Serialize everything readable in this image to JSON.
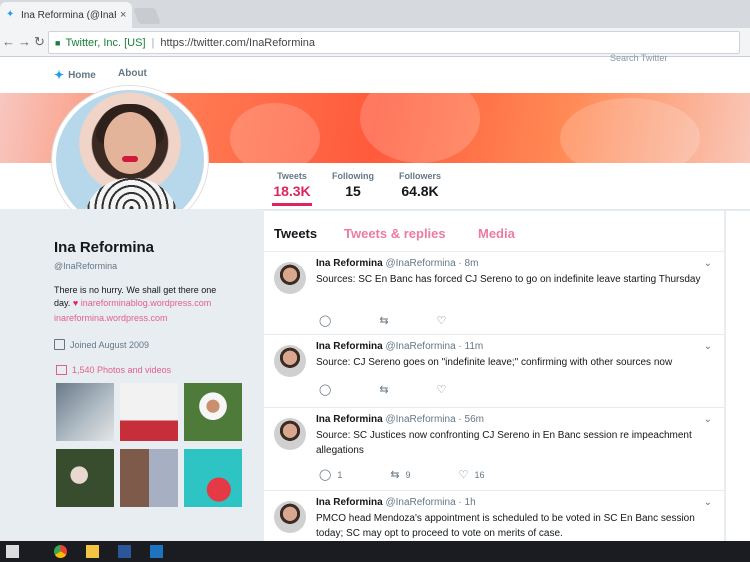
{
  "browser": {
    "tab_title": "Ina Reformina (@InaRef",
    "tab_close": "×",
    "org": "Twitter, Inc. [US]",
    "url": "https://twitter.com/InaReformina"
  },
  "twitter_nav": {
    "home_label": "Home",
    "about_label": "About",
    "search_placeholder": "Search Twitter"
  },
  "profile_stats": [
    {
      "label": "Tweets",
      "value": "18.3K"
    },
    {
      "label": "Following",
      "value": "15"
    },
    {
      "label": "Followers",
      "value": "64.8K"
    }
  ],
  "profile": {
    "name": "Ina Reformina",
    "handle": "@InaReformina",
    "bio_line1": "There is no hurry. We shall get there one",
    "bio_line2_start": "day.",
    "bio_link1": "inareforminablog.wordpress.com",
    "bio_link2": "inareformina.wordpress.com",
    "joined": "Joined August 2009",
    "photos": "1,540 Photos and videos"
  },
  "timeline_tabs": [
    {
      "label": "Tweets",
      "color": "#14171a"
    },
    {
      "label": "Tweets & replies",
      "color": "#e0245e"
    },
    {
      "label": "Media",
      "color": "#e0245e"
    }
  ],
  "tweets": [
    {
      "name": "Ina Reformina",
      "meta": "@InaReformina · 8m",
      "text": "Sources: SC En Banc has forced CJ Sereno to go on indefinite leave starting Thursday",
      "replies": "",
      "retweets": "",
      "likes": ""
    },
    {
      "name": "Ina Reformina",
      "meta": "@InaReformina · 11m",
      "text": "Source: CJ Sereno goes on \"indefinite leave;\" confirming with other sources now",
      "replies": "",
      "retweets": "",
      "likes": ""
    },
    {
      "name": "Ina Reformina",
      "meta": "@InaReformina · 56m",
      "text": "Source: SC Justices now confronting CJ Sereno in En Banc session re impeachment allegations",
      "replies": "1",
      "retweets": "9",
      "likes": "16"
    },
    {
      "name": "Ina Reformina",
      "meta": "@InaReformina · 1h",
      "text": "PMCO head Mendoza's appointment is scheduled to be voted in SC En Banc session today; SC may opt to proceed to vote on merits of case.",
      "replies": "",
      "retweets": "",
      "likes": ""
    }
  ],
  "colors": {
    "accent": "#e0245e",
    "twitter_blue": "#1da1f2"
  }
}
